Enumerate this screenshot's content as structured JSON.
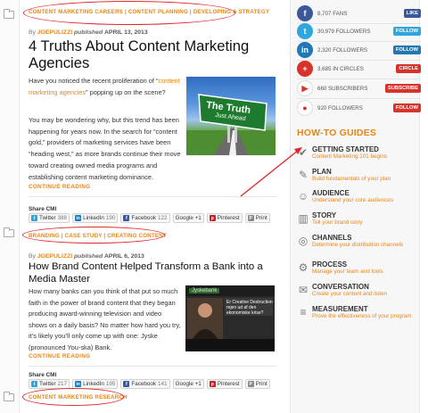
{
  "articles": [
    {
      "categories": "CONTENT MARKETING CAREERS | CONTENT PLANNING | DEVELOPING A STRATEGY",
      "by": "By",
      "author": "JOEPULIZZI",
      "published": "published",
      "date": "APRIL 13, 2013",
      "title": "4 Truths About Content Marketing Agencies",
      "excerpt_p1_a": "Have you noticed the recent proliferation of “",
      "excerpt_link": "content marketing agencies",
      "excerpt_p1_b": "” popping up on the scene?",
      "excerpt_p2": "You may be wondering why, but this trend has been happening for years now. In the search for “content gold,” providers of marketing services have been “heading west,” as more brands continue their move toward creating owned media programs and establishing content marketing dominance.",
      "continue": "CONTINUE READING",
      "share_label": "Share CMI",
      "image_text_1": "The Truth",
      "image_text_2": "Just Ahead",
      "share": {
        "twitter": {
          "label": "Twitter",
          "count": "388"
        },
        "linkedin": {
          "label": "LinkedIn",
          "count": "190"
        },
        "facebook": {
          "label": "Facebook",
          "count": "122"
        },
        "google": {
          "label": "Google +1",
          "count": ""
        },
        "pinterest": {
          "label": "Pinterest",
          "count": ""
        },
        "print": {
          "label": "Print",
          "count": ""
        }
      }
    },
    {
      "categories": "BRANDING | CASE STUDY | CREATING CONTENT",
      "by": "By",
      "author": "JOEPULIZZI",
      "published": "published",
      "date": "APRIL 6, 2013",
      "title": "How Brand Content Helped Transform a Bank into a Media Master",
      "excerpt": "How many banks can you think of that put so much faith in the power of brand content that they began producing award-winning television and video shows on a daily basis? No matter how hard you try, it’s likely you’ll only come up with one: Jyske (pronounced You-ska) Bank.",
      "continue": "CONTINUE READING",
      "share_label": "Share CMI",
      "image_text_1": "Er Creative Destruction",
      "image_text_2": "rejen ud af den",
      "image_text_3": "ekonomiske krise?",
      "image_logo": "Jyskebank",
      "share": {
        "twitter": {
          "label": "Twitter",
          "count": "217"
        },
        "linkedin": {
          "label": "LinkedIn",
          "count": "195"
        },
        "facebook": {
          "label": "Facebook",
          "count": "141"
        },
        "google": {
          "label": "Google +1",
          "count": ""
        },
        "pinterest": {
          "label": "Pinterest",
          "count": ""
        },
        "print": {
          "label": "Print",
          "count": ""
        }
      }
    },
    {
      "categories": "CONTENT MARKETING RESEARCH"
    }
  ],
  "sidebar": {
    "social": [
      {
        "icon": "f",
        "text": "8,707 FANS",
        "button": "LIKE",
        "color": "#3b5998",
        "btn_color": "#3b5998",
        "icon_name": "facebook-icon"
      },
      {
        "icon": "t",
        "text": "30,979 FOLLOWERS",
        "button": "FOLLOW",
        "color": "#2fa6dc",
        "btn_color": "#2fa6dc",
        "icon_name": "twitter-icon"
      },
      {
        "icon": "in",
        "text": "2,320 FOLLOWERS",
        "button": "FOLLOW",
        "color": "#2278b5",
        "btn_color": "#2278b5",
        "icon_name": "linkedin-icon"
      },
      {
        "icon": "+",
        "text": "3,685 IN CIRCLES",
        "button": "CIRCLE",
        "color": "#d8332a",
        "btn_color": "#d8332a",
        "icon_name": "google-plus-icon"
      },
      {
        "icon": "▶",
        "text": "660 SUBSCRIBERS",
        "button": "SUBSCRIBE",
        "color": "#ffffff",
        "btn_color": "#d8332a",
        "icon_name": "youtube-icon"
      },
      {
        "icon": "●",
        "text": "920 FOLLOWERS",
        "button": "FOLLOW",
        "color": "#ffffff",
        "btn_color": "#d8332a",
        "icon_name": "pinterest-icon"
      }
    ],
    "howto_heading": "HOW-TO GUIDES",
    "guides": [
      {
        "title": "GETTING STARTED",
        "sub": "Content Marketing 101 begins",
        "icon": "✔",
        "icon_name": "checkmark-icon"
      },
      {
        "title": "PLAN",
        "sub": "Build fundamentals of your plan",
        "icon": "✎",
        "icon_name": "pencil-icon"
      },
      {
        "title": "AUDIENCE",
        "sub": "Understand your core audiences",
        "icon": "☺",
        "icon_name": "people-icon"
      },
      {
        "title": "STORY",
        "sub": "Tell your brand story",
        "icon": "▥",
        "icon_name": "book-icon"
      },
      {
        "title": "CHANNELS",
        "sub": "Determine your distribution channels",
        "icon": "◎",
        "icon_name": "broadcast-icon"
      },
      {
        "title": "PROCESS",
        "sub": "Manage your team and tools",
        "icon": "⚙",
        "icon_name": "gears-icon"
      },
      {
        "title": "CONVERSATION",
        "sub": "Create your content and listen",
        "icon": "✉",
        "icon_name": "chat-icon"
      },
      {
        "title": "MEASUREMENT",
        "sub": "Prove the effectiveness of your program",
        "icon": "≡",
        "icon_name": "bar-chart-icon"
      }
    ]
  },
  "colors": {
    "accent": "#e98514",
    "annotation": "#e0282a"
  }
}
